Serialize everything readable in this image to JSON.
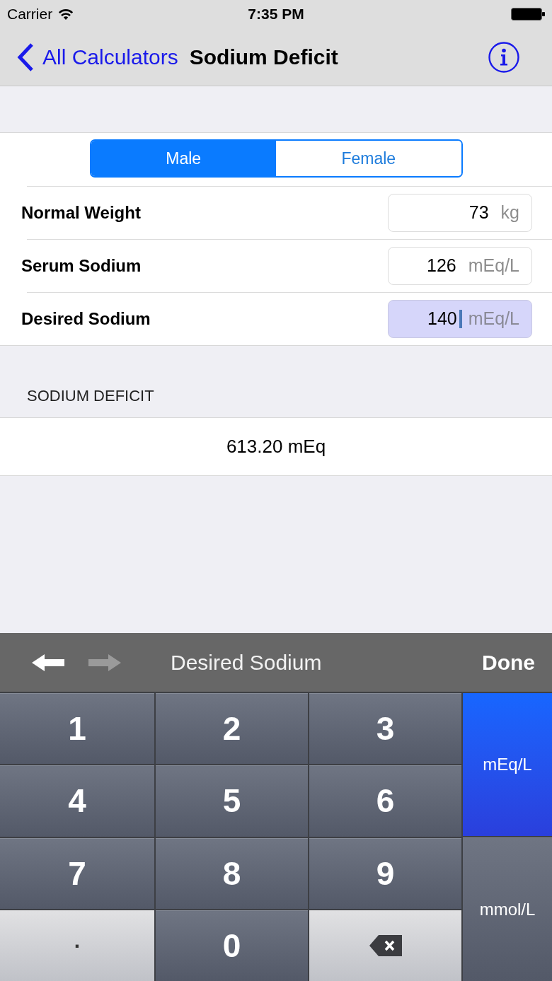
{
  "status_bar": {
    "carrier": "Carrier",
    "time": "7:35 PM"
  },
  "nav_bar": {
    "back_label": "All Calculators",
    "title": "Sodium Deficit"
  },
  "sex_segments": [
    {
      "label": "Male",
      "selected": true
    },
    {
      "label": "Female",
      "selected": false
    }
  ],
  "inputs": [
    {
      "label": "Normal Weight",
      "value": "73",
      "unit": "kg",
      "focused": false
    },
    {
      "label": "Serum Sodium",
      "value": "126",
      "unit": "mEq/L",
      "focused": false
    },
    {
      "label": "Desired Sodium",
      "value": "140",
      "unit": "mEq/L",
      "focused": true
    }
  ],
  "result": {
    "header": "SODIUM DEFICIT",
    "value": "613.20 mEq"
  },
  "keyboard_toolbar": {
    "arrows": [
      {
        "kind": "previous",
        "disabled": false
      },
      {
        "kind": "next",
        "disabled": true
      }
    ],
    "title": "Desired Sodium",
    "done": "Done"
  },
  "keypad": {
    "keys": [
      {
        "kind": "digit",
        "label": "1"
      },
      {
        "kind": "digit",
        "label": "2"
      },
      {
        "kind": "digit",
        "label": "3"
      },
      {
        "kind": "digit",
        "label": "4"
      },
      {
        "kind": "digit",
        "label": "5"
      },
      {
        "kind": "digit",
        "label": "6"
      },
      {
        "kind": "digit",
        "label": "7"
      },
      {
        "kind": "digit",
        "label": "8"
      },
      {
        "kind": "digit",
        "label": "9"
      },
      {
        "kind": "decimal",
        "label": "."
      },
      {
        "kind": "digit",
        "label": "0"
      },
      {
        "kind": "backspace"
      }
    ],
    "unit_keys": [
      {
        "label": "mEq/L",
        "selected": true
      },
      {
        "label": "mmol/L",
        "selected": false
      }
    ]
  }
}
